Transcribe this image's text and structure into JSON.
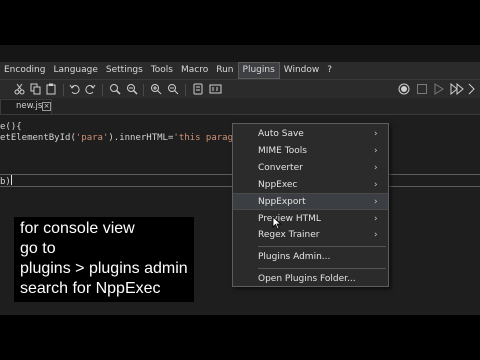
{
  "menubar": {
    "items": [
      "Encoding",
      "Language",
      "Settings",
      "Tools",
      "Macro",
      "Run",
      "Plugins",
      "Window",
      "?"
    ],
    "active_item": "Plugins"
  },
  "toolbar": {
    "icons": [
      "cut-icon",
      "copy-icon",
      "paste-icon",
      "undo-icon",
      "redo-icon",
      "find-icon",
      "replace-icon",
      "zoom-in-icon",
      "zoom-out-icon",
      "sync-icon",
      "wrap-icon",
      "record-macro-icon",
      "stop-macro-icon",
      "play-macro-icon",
      "run-macro-multiple-icon"
    ]
  },
  "tab": {
    "label": "new.js",
    "close_glyph": "×"
  },
  "editor": {
    "lines": [
      {
        "segments": [
          {
            "text": "e(){",
            "color": "#d4d4d4"
          }
        ]
      },
      {
        "segments": [
          {
            "text": "etElementById(",
            "color": "#d4d4d4"
          },
          {
            "text": "'para'",
            "color": "#ce9178"
          },
          {
            "text": ").innerHTML=",
            "color": "#d4d4d4"
          },
          {
            "text": "'this paragr",
            "color": "#ce9178"
          }
        ]
      },
      {
        "segments": [
          {
            "text": "b)",
            "color": "#d4d4d4"
          }
        ]
      }
    ]
  },
  "plugins_menu": {
    "items": [
      {
        "label": "Auto Save",
        "has_submenu": true
      },
      {
        "label": "MIME Tools",
        "has_submenu": true
      },
      {
        "label": "Converter",
        "has_submenu": true
      },
      {
        "label": "NppExec",
        "has_submenu": true
      },
      {
        "label": "NppExport",
        "has_submenu": true,
        "highlighted": true
      },
      {
        "label": "Preview HTML",
        "has_submenu": true
      },
      {
        "label": "Regex Trainer",
        "has_submenu": true
      },
      {
        "label": "Plugins Admin...",
        "has_submenu": false
      },
      {
        "label": "Open Plugins Folder...",
        "has_submenu": false
      }
    ],
    "submenu_glyph": "›"
  },
  "caption": {
    "lines": [
      "for console view",
      "go to",
      "plugins > plugins admin",
      "search for NppExec"
    ]
  },
  "colors": {
    "background": "#1e1e1e",
    "menu_bg": "#2b2b2b",
    "string_literal": "#ce9178",
    "caption_bg": "#000000",
    "caption_text": "#ffffff"
  }
}
